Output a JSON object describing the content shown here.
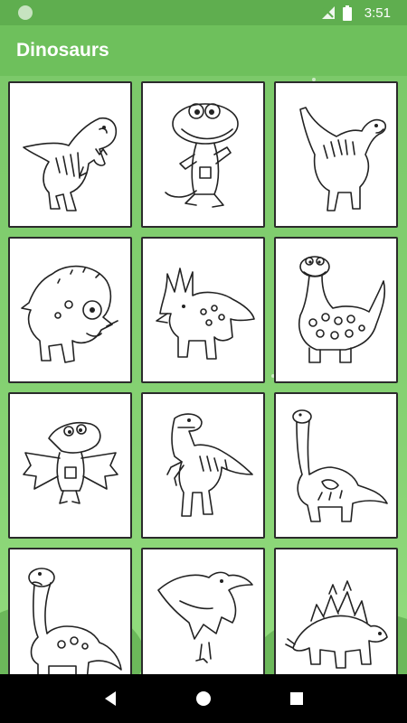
{
  "status_bar": {
    "time": "3:51",
    "icons": [
      "notification-dot-icon",
      "signal-icon",
      "battery-icon"
    ]
  },
  "app_bar": {
    "title": "Dinosaurs"
  },
  "gallery": {
    "items": [
      {
        "icon": "t-rex-drawing"
      },
      {
        "icon": "smiling-dino-drawing"
      },
      {
        "icon": "sauropod-drawing"
      },
      {
        "icon": "triceratops-drawing"
      },
      {
        "icon": "styracosaurus-drawing"
      },
      {
        "icon": "spotted-longneck-drawing"
      },
      {
        "icon": "pterodactyl-drawing"
      },
      {
        "icon": "raptor-drawing"
      },
      {
        "icon": "brachiosaurus-drawing"
      },
      {
        "icon": "diplodocus-drawing"
      },
      {
        "icon": "pteranodon-drawing"
      },
      {
        "icon": "stegosaurus-drawing"
      }
    ]
  },
  "nav_bar": {
    "buttons": [
      "back-icon",
      "home-icon",
      "recents-icon"
    ]
  },
  "colors": {
    "status_bar": "#5fae4f",
    "app_bar": "#6ec05c",
    "background": "#7ec86a",
    "nav_bar": "#000000",
    "card_border": "#2b2b2b"
  }
}
